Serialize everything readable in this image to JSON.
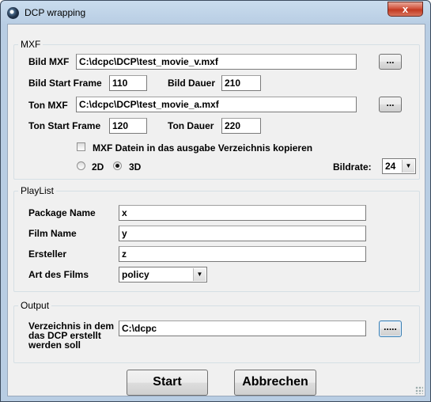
{
  "window": {
    "title": "DCP wrapping",
    "close_label": "x"
  },
  "mxf": {
    "group_label": "MXF",
    "bild_mxf_label": "Bild MXF",
    "bild_mxf_value": "C:\\dcpc\\DCP\\test_movie_v.mxf",
    "bild_start_label": "Bild Start Frame",
    "bild_start_value": "110",
    "bild_dauer_label": "Bild Dauer",
    "bild_dauer_value": "210",
    "ton_mxf_label": "Ton MXF",
    "ton_mxf_value": "C:\\dcpc\\DCP\\test_movie_a.mxf",
    "ton_start_label": "Ton Start Frame",
    "ton_start_value": "120",
    "ton_dauer_label": "Ton Dauer",
    "ton_dauer_value": "220",
    "browse_label": "...",
    "copy_checkbox_label": "MXF Datein in das ausgabe Verzeichnis kopieren",
    "copy_checked": false,
    "radio_2d_label": "2D",
    "radio_3d_label": "3D",
    "selected_mode": "3D",
    "bildrate_label": "Bildrate:",
    "bildrate_value": "24"
  },
  "playlist": {
    "group_label": "PlayList",
    "package_name_label": "Package Name",
    "package_name_value": "x",
    "film_name_label": "Film Name",
    "film_name_value": "y",
    "ersteller_label": "Ersteller",
    "ersteller_value": "z",
    "art_label": "Art des Films",
    "art_value": "policy"
  },
  "output": {
    "group_label": "Output",
    "dir_label": "Verzeichnis in dem das DCP erstellt werden soll",
    "dir_value": "C:\\dcpc",
    "browse_label": "....."
  },
  "actions": {
    "start_label": "Start",
    "cancel_label": "Abbrechen"
  }
}
